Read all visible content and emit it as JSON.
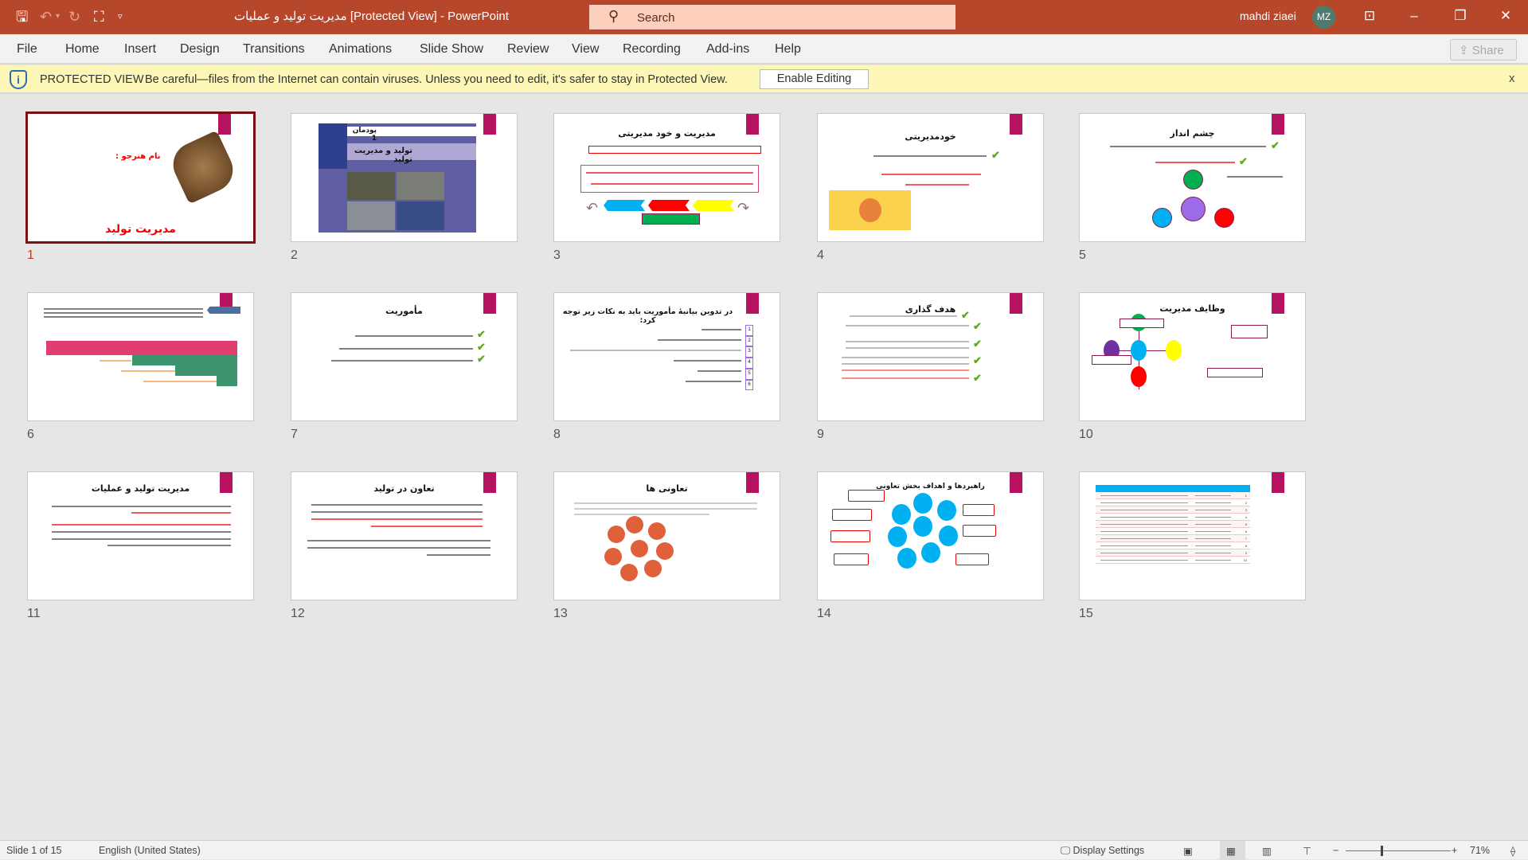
{
  "titlebar": {
    "doc_title": "مدیریت تولید و عملیات [Protected View]  -  PowerPoint",
    "search_placeholder": "Search",
    "user_name": "mahdi ziaei",
    "user_initials": "MZ",
    "accent": "#b7472a"
  },
  "menu": {
    "tabs": [
      "File",
      "Home",
      "Insert",
      "Design",
      "Transitions",
      "Animations",
      "Slide Show",
      "Review",
      "View",
      "Recording",
      "Add-ins",
      "Help"
    ],
    "share": "Share"
  },
  "protected_view": {
    "label": "PROTECTED VIEW",
    "message": "Be careful—files from the Internet can contain viruses. Unless you need to edit, it's safer to stay in Protected View.",
    "enable_button": "Enable Editing",
    "close": "x"
  },
  "slides": [
    {
      "number": "1",
      "title": "مدیریت تولید",
      "subtitle": "نام هنرجو :",
      "selected": true
    },
    {
      "number": "2",
      "title": "تولید و مدیریت تولید",
      "subtitle": "پودمان 1"
    },
    {
      "number": "3",
      "title": "مدیریت و خود مدیریتی"
    },
    {
      "number": "4",
      "title": "خودمدیریتی"
    },
    {
      "number": "5",
      "title": "چشم انداز"
    },
    {
      "number": "6"
    },
    {
      "number": "7",
      "title": "مأموریت"
    },
    {
      "number": "8",
      "title": "در تدوین بیانیهٔ مأموریت باید به نکات زیر توجه کرد:",
      "list": [
        "1",
        "2",
        "3",
        "4",
        "5",
        "6"
      ]
    },
    {
      "number": "9",
      "title": "هدف گذاری"
    },
    {
      "number": "10",
      "title": "وظایف مدیریت"
    },
    {
      "number": "11",
      "title": "مدیریت تولید و عملیات"
    },
    {
      "number": "12",
      "title": "تعاون در تولید"
    },
    {
      "number": "13",
      "title": "تعاونی ها"
    },
    {
      "number": "14",
      "title": "راهبردها و اهداف بخش تعاونی"
    },
    {
      "number": "15",
      "table_rows": [
        "1",
        "2",
        "3",
        "4",
        "5",
        "6",
        "7",
        "8",
        "9",
        "10"
      ]
    }
  ],
  "statusbar": {
    "slide_info": "Slide 1 of 15",
    "language": "English (United States)",
    "display_settings": "Display Settings",
    "zoom": "71%",
    "zoom_level_percent": 71
  }
}
